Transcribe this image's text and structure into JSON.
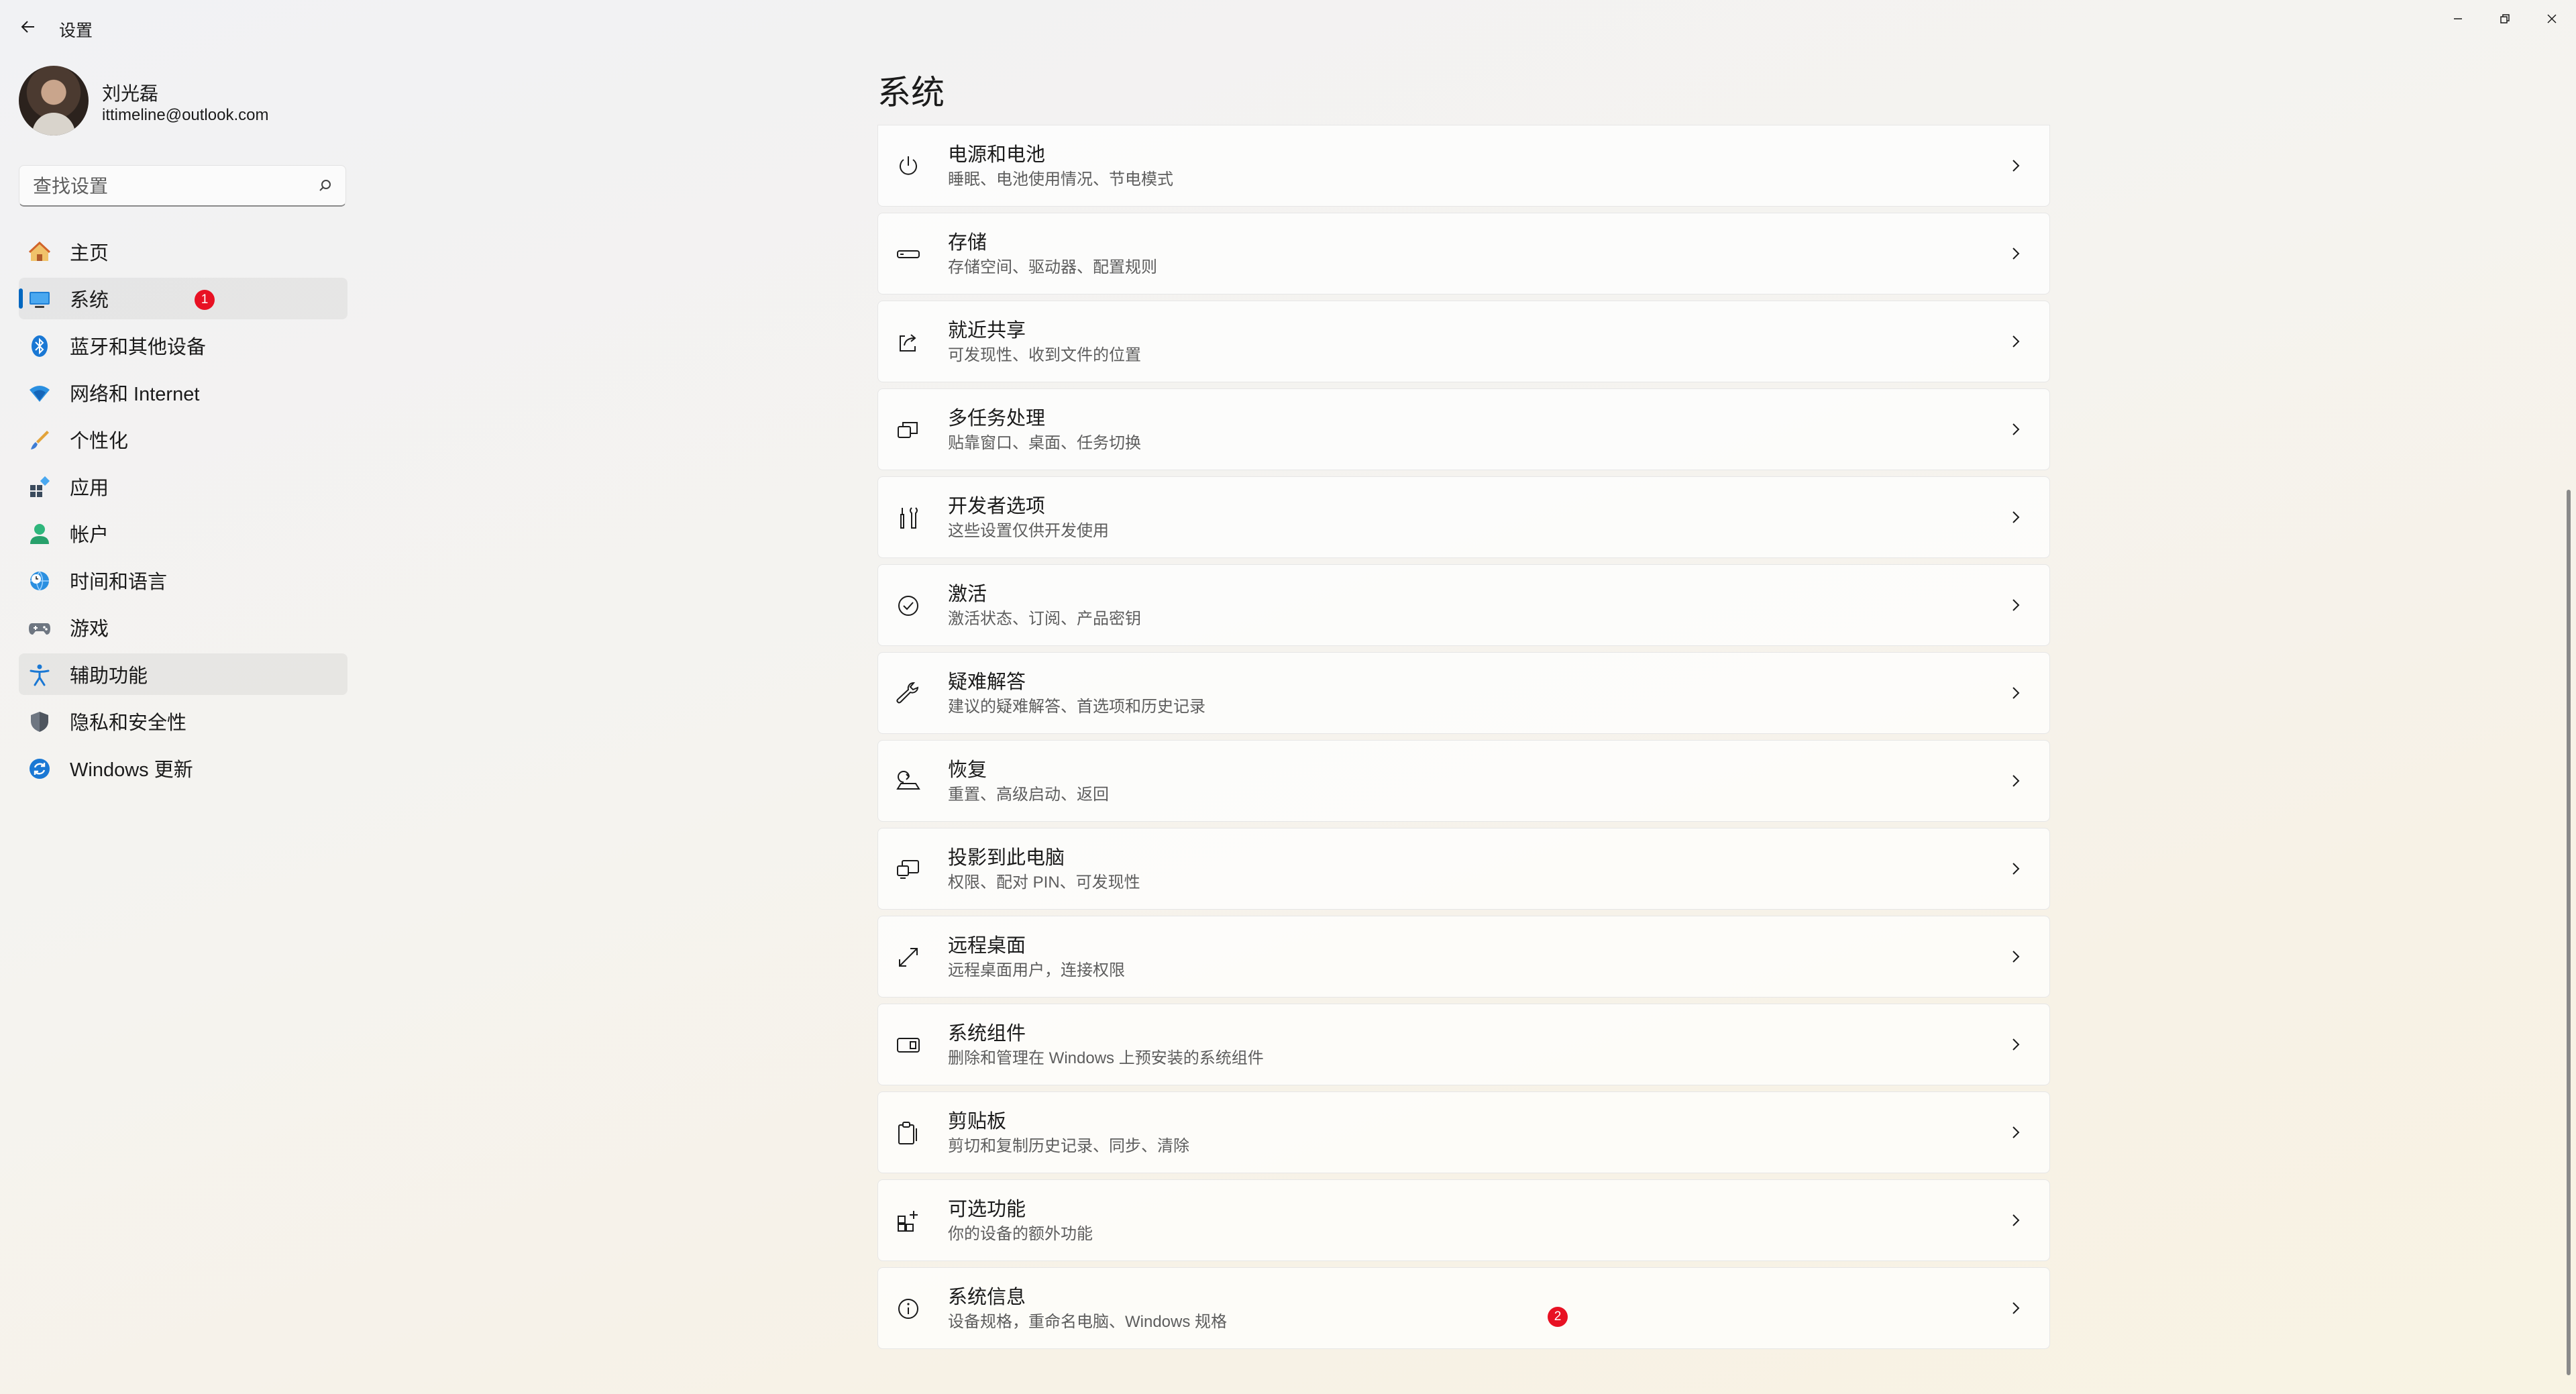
{
  "window": {
    "title": "设置"
  },
  "user": {
    "name": "刘光磊",
    "email": "ittimeline@outlook.com"
  },
  "search": {
    "placeholder": "查找设置"
  },
  "nav": {
    "items": [
      {
        "label": "主页",
        "icon": "home-icon"
      },
      {
        "label": "系统",
        "icon": "system-icon",
        "badge": "1"
      },
      {
        "label": "蓝牙和其他设备",
        "icon": "bluetooth-icon"
      },
      {
        "label": "网络和 Internet",
        "icon": "wifi-icon"
      },
      {
        "label": "个性化",
        "icon": "brush-icon"
      },
      {
        "label": "应用",
        "icon": "apps-icon"
      },
      {
        "label": "帐户",
        "icon": "account-icon"
      },
      {
        "label": "时间和语言",
        "icon": "globe-clock-icon"
      },
      {
        "label": "游戏",
        "icon": "gamepad-icon"
      },
      {
        "label": "辅助功能",
        "icon": "accessibility-icon"
      },
      {
        "label": "隐私和安全性",
        "icon": "shield-icon"
      },
      {
        "label": "Windows 更新",
        "icon": "update-icon"
      }
    ]
  },
  "main": {
    "title": "系统",
    "items": [
      {
        "title": "电源和电池",
        "subtitle": "睡眠、电池使用情况、节电模式",
        "icon": "power-icon"
      },
      {
        "title": "存储",
        "subtitle": "存储空间、驱动器、配置规则",
        "icon": "storage-icon"
      },
      {
        "title": "就近共享",
        "subtitle": "可发现性、收到文件的位置",
        "icon": "share-icon"
      },
      {
        "title": "多任务处理",
        "subtitle": "贴靠窗口、桌面、任务切换",
        "icon": "multitask-icon"
      },
      {
        "title": "开发者选项",
        "subtitle": "这些设置仅供开发使用",
        "icon": "developer-icon"
      },
      {
        "title": "激活",
        "subtitle": "激活状态、订阅、产品密钥",
        "icon": "activation-icon"
      },
      {
        "title": "疑难解答",
        "subtitle": "建议的疑难解答、首选项和历史记录",
        "icon": "wrench-icon"
      },
      {
        "title": "恢复",
        "subtitle": "重置、高级启动、返回",
        "icon": "recovery-icon"
      },
      {
        "title": "投影到此电脑",
        "subtitle": "权限、配对 PIN、可发现性",
        "icon": "project-icon"
      },
      {
        "title": "远程桌面",
        "subtitle": "远程桌面用户，连接权限",
        "icon": "remote-desktop-icon"
      },
      {
        "title": "系统组件",
        "subtitle": "删除和管理在 Windows 上预安装的系统组件",
        "icon": "components-icon"
      },
      {
        "title": "剪贴板",
        "subtitle": "剪切和复制历史记录、同步、清除",
        "icon": "clipboard-icon"
      },
      {
        "title": "可选功能",
        "subtitle": "你的设备的额外功能",
        "icon": "optional-features-icon"
      },
      {
        "title": "系统信息",
        "subtitle": "设备规格，重命名电脑、Windows 规格",
        "icon": "info-icon",
        "badge": "2"
      }
    ]
  },
  "colors": {
    "accent": "#0067c0",
    "badge": "#e81123"
  }
}
